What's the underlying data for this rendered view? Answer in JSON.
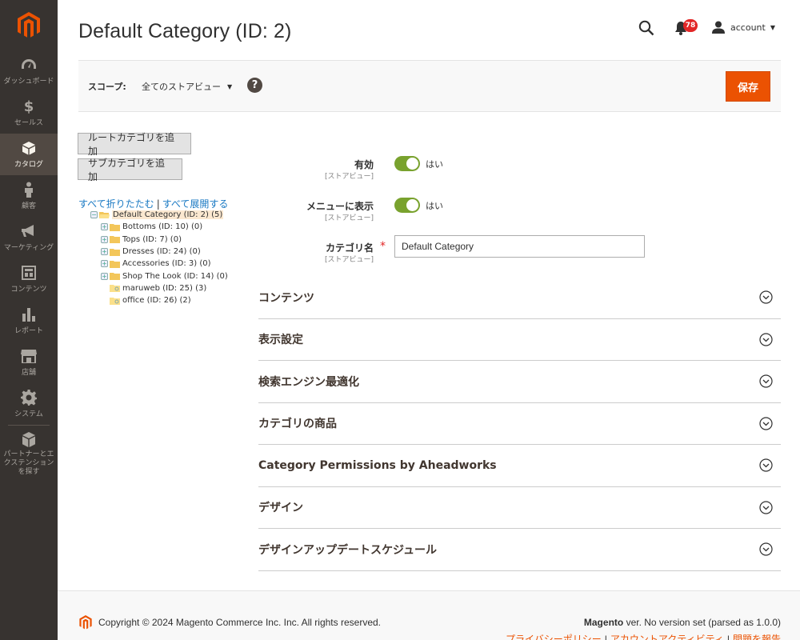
{
  "sidebar": {
    "items": [
      {
        "label": "ダッシュボード",
        "icon": "dashboard-icon"
      },
      {
        "label": "セールス",
        "icon": "dollar-icon"
      },
      {
        "label": "カタログ",
        "icon": "catalog-box-icon",
        "active": true
      },
      {
        "label": "顧客",
        "icon": "customer-icon"
      },
      {
        "label": "マーケティング",
        "icon": "megaphone-icon"
      },
      {
        "label": "コンテンツ",
        "icon": "content-icon"
      },
      {
        "label": "レポート",
        "icon": "report-bars-icon"
      },
      {
        "label": "店舗",
        "icon": "store-icon"
      },
      {
        "label": "システム",
        "icon": "gear-icon"
      },
      {
        "label": "パートナーとエクステンションを探す",
        "icon": "extensions-box-icon"
      }
    ]
  },
  "header": {
    "title": "Default Category (ID: 2)",
    "notifications_count": "78",
    "account_label": "account"
  },
  "scope": {
    "label": "スコープ:",
    "selected": "全てのストアビュー",
    "help": "?"
  },
  "actions": {
    "save_label": "保存",
    "add_root_label": "ルートカテゴリを追加",
    "add_sub_label": "サブカテゴリを追加"
  },
  "tree": {
    "collapse_all": "すべて折りたたむ",
    "separator": "|",
    "expand_all": "すべて展開する",
    "root": "Default Category (ID: 2) (5)",
    "children": [
      {
        "label": "Bottoms (ID: 10) (0)",
        "expandable": true
      },
      {
        "label": "Tops (ID: 7) (0)",
        "expandable": true
      },
      {
        "label": "Dresses (ID: 24) (0)",
        "expandable": true
      },
      {
        "label": "Accessories (ID: 3) (0)",
        "expandable": true
      },
      {
        "label": "Shop The Look (ID: 14) (0)",
        "expandable": true
      },
      {
        "label": "maruweb (ID: 25) (3)",
        "expandable": false
      },
      {
        "label": "office (ID: 26) (2)",
        "expandable": false
      }
    ]
  },
  "form": {
    "enabled": {
      "label": "有効",
      "scope": "[ストアビュー]",
      "value": "はい"
    },
    "include_in_menu": {
      "label": "メニューに表示",
      "scope": "[ストアビュー]",
      "value": "はい"
    },
    "category_name": {
      "label": "カテゴリ名",
      "scope": "[ストアビュー]",
      "value": "Default Category",
      "required_mark": "*"
    }
  },
  "sections": [
    "コンテンツ",
    "表示設定",
    "検索エンジン最適化",
    "カテゴリの商品",
    "Category Permissions by Aheadworks",
    "デザイン",
    "デザインアップデートスケジュール"
  ],
  "footer": {
    "copyright": "Copyright © 2024 Magento Commerce Inc. Inc. All rights reserved.",
    "version_brand": "Magento",
    "version_text": " ver. No version set (parsed as 1.0.0)",
    "links": [
      "プライバシーポリシー",
      "アカウントアクティビティ",
      "問題を報告"
    ],
    "link_separator": "|"
  },
  "colors": {
    "accent": "#eb5202",
    "sidebar_bg": "#373330",
    "toggle_on": "#79a22e",
    "link": "#1979c3"
  }
}
